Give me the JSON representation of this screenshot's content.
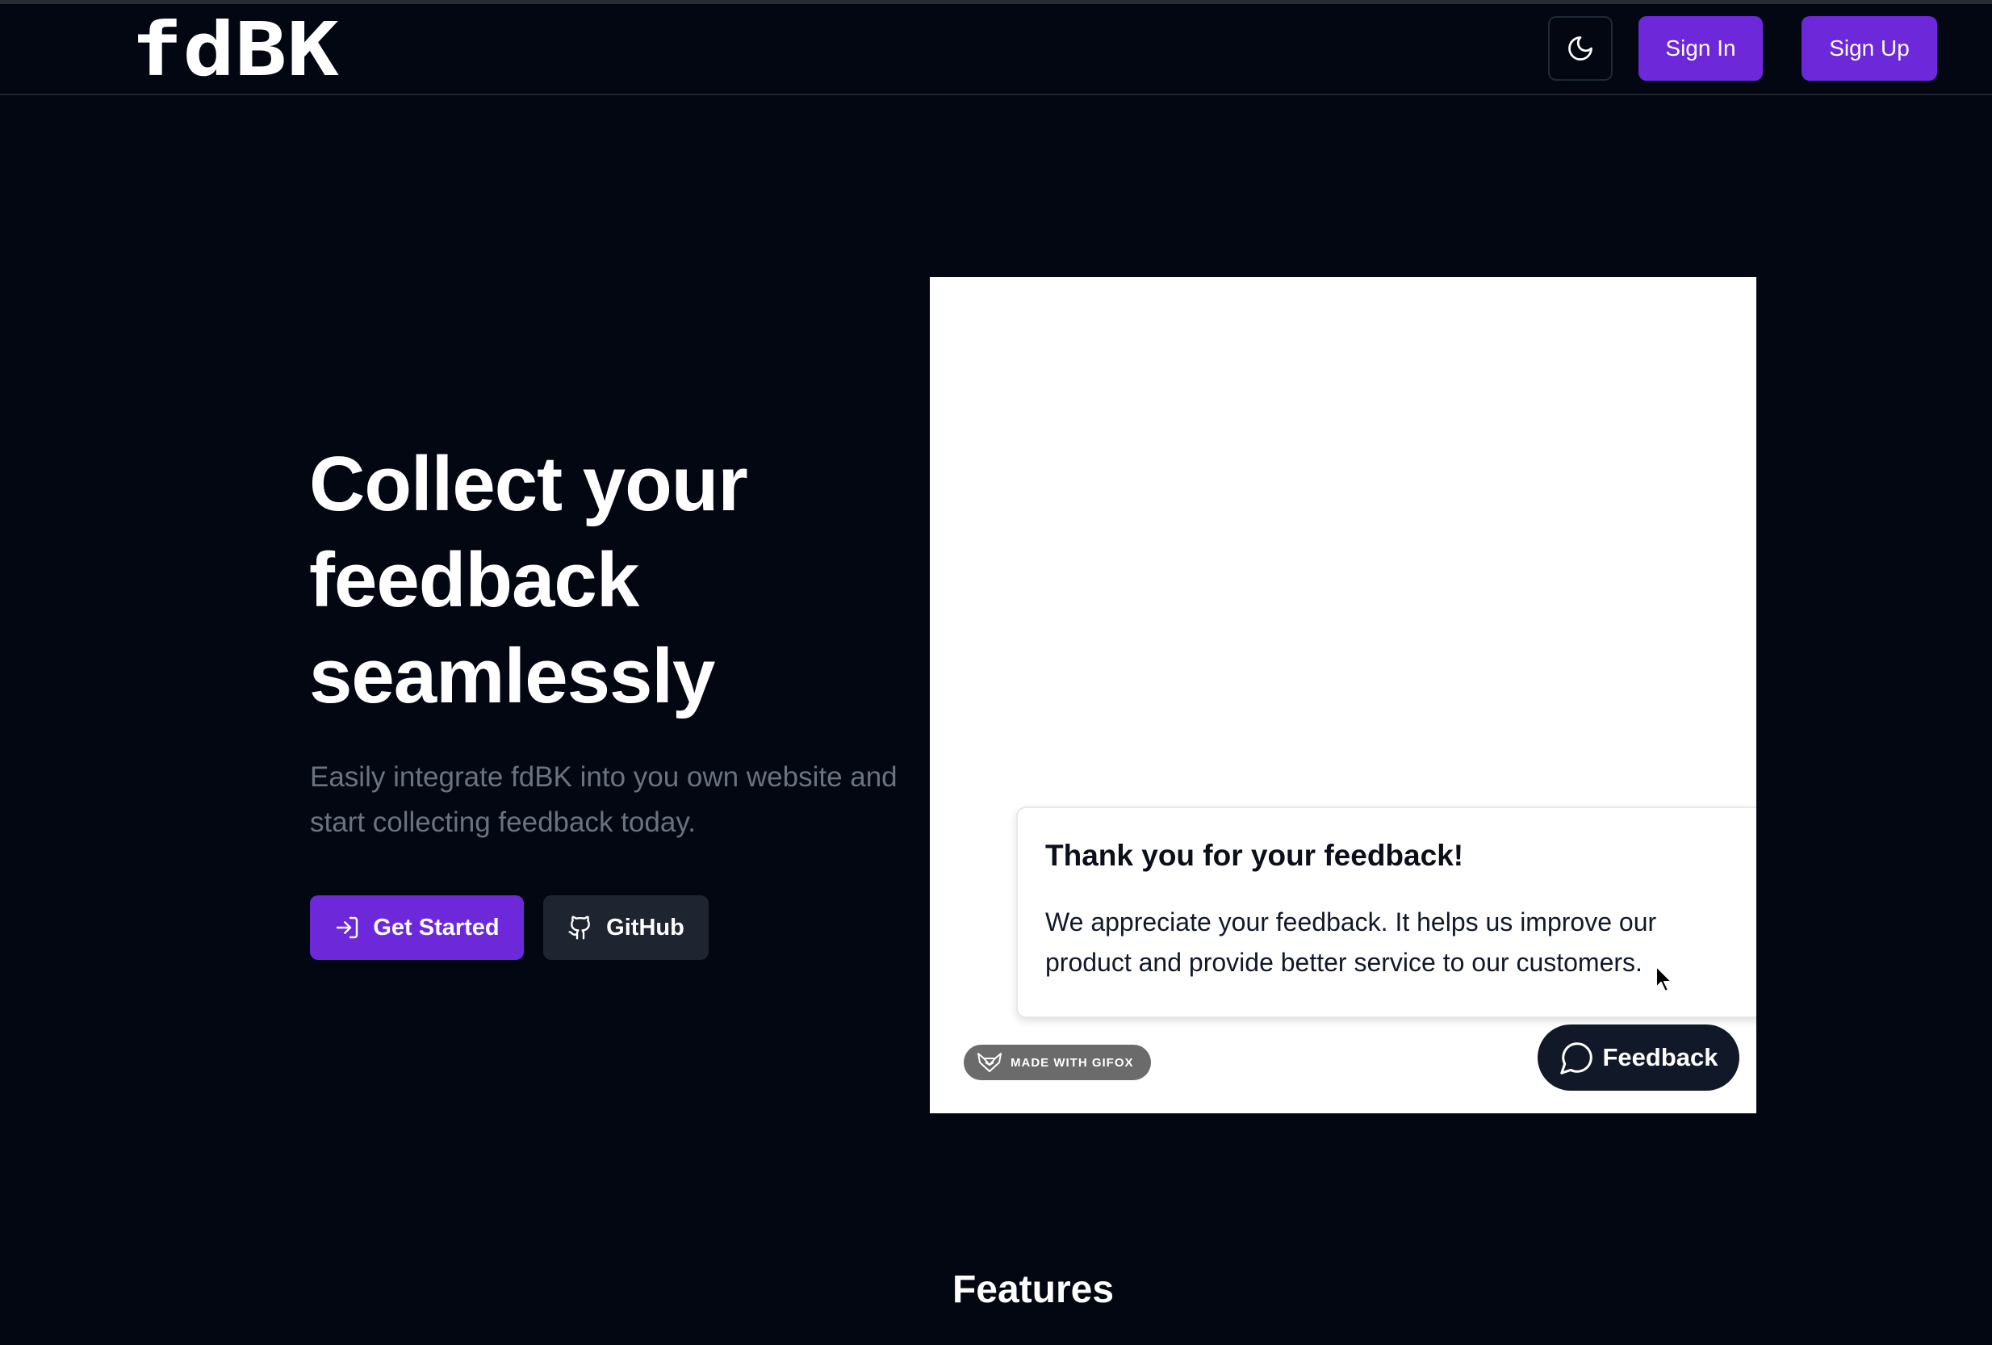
{
  "header": {
    "logo_text": "fdBK",
    "theme_toggle_icon": "moon-icon",
    "sign_in_label": "Sign In",
    "sign_up_label": "Sign Up"
  },
  "hero": {
    "title_lines": [
      "Collect your",
      "feedback",
      "seamlessly"
    ],
    "subtitle_lines": [
      "Easily integrate fdBK into you own website and",
      "start collecting feedback today."
    ],
    "get_started_label": "Get Started",
    "get_started_icon": "login-arrow-icon",
    "github_label": "GitHub",
    "github_icon": "github-icon"
  },
  "demo": {
    "card_title": "Thank you for your feedback!",
    "card_body_lines": [
      "We appreciate your feedback. It helps us improve our",
      "product and provide better service to our customers."
    ],
    "badge_text": "MADE WITH GIFOX",
    "badge_icon": "fox-icon",
    "feedback_button_label": "Feedback",
    "feedback_button_icon": "chat-bubble-icon"
  },
  "features": {
    "title": "Features"
  },
  "colors": {
    "background": "#030712",
    "accent": "#6d28d9",
    "muted_text": "#6b7280",
    "secondary_button": "#1f2431"
  }
}
